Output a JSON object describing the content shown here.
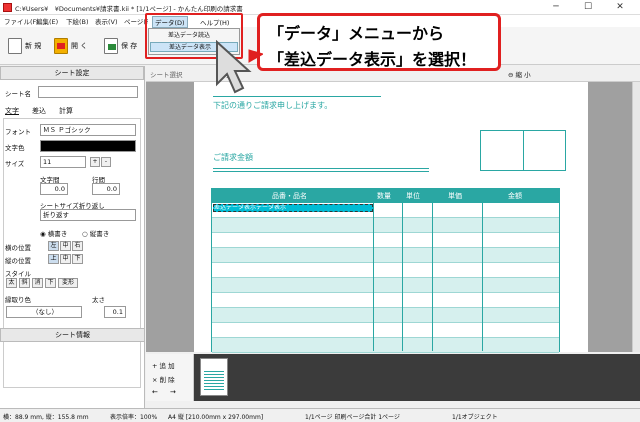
{
  "window": {
    "title": "C:¥Users¥　¥Documents¥請求書.kii * [1/1ページ] - かんたん印刷の請求書",
    "minimize": "─",
    "maximize": "☐",
    "close": "✕"
  },
  "menubar": [
    "ファイル(F)",
    "編集(E)",
    "下絵(B)",
    "表示(V)",
    "ページ(P)"
  ],
  "toolbar": {
    "new_label": "新 規",
    "open_label": "開 く",
    "save_label": "保 存"
  },
  "dropdown": {
    "menu_data": "データ(D)",
    "menu_help": "ヘルプ(H)",
    "items": [
      "差込データ読込",
      "差込データ表示"
    ]
  },
  "callout": {
    "line1": "「データ」メニューから",
    "line2": "「差込データ表示」を選択！"
  },
  "left_panel": {
    "header": "シート設定",
    "sheet_name_label": "シート名",
    "sheet_name_value": "",
    "tabs": [
      "文字",
      "差込",
      "計算"
    ],
    "font_label": "フォント",
    "font_value": "ＭＳ Ｐゴシック",
    "color_label": "文字色",
    "size_label": "サイズ",
    "size_value": "11",
    "char_spacing_label": "文字間",
    "char_spacing_value": "0.0",
    "line_spacing_label": "行間",
    "line_spacing_value": "0.0",
    "wrap_label": "シートサイズ折り返し",
    "wrap_value": "折り返す",
    "horizontal_label": "横書き",
    "vertical_label": "縦書き",
    "h_align_label": "横の位置",
    "h_align": [
      "左",
      "中",
      "右"
    ],
    "v_align_label": "縦の位置",
    "v_align": [
      "上",
      "中",
      "下"
    ],
    "style_label": "スタイル",
    "styles": [
      "太",
      "斜",
      "消",
      "下",
      "変形"
    ],
    "border_color_label": "縁取り色",
    "border_color_value": "（なし）",
    "thickness_label": "太さ",
    "thickness_value": "0.1",
    "footer": "シート情報"
  },
  "subtoolbar": {
    "select_label": "シート選択",
    "text_label": "文 字",
    "zoom_out_label": "縮 小"
  },
  "document": {
    "greeting": "下記の通りご請求申し上げます。",
    "amount_label": "ご請求金額",
    "table_headers": [
      "品番・品名",
      "数量",
      "単位",
      "単価",
      "金額"
    ],
    "selected_cell_text": "差込データ表示データ表示"
  },
  "thumb_panel": {
    "add_label": "追 加",
    "delete_label": "削 除"
  },
  "status": {
    "position": "横：88.9 mm, 縦：155.8 mm",
    "zoom": "表示倍率：100%",
    "paper": "A4 縦 [210.00mm x 297.00mm]",
    "page": "1/1ページ 印刷ページ合計 1ページ",
    "objects": "1/1オブジェクト"
  },
  "colors": {
    "accent": "#e02020",
    "teal": "#2aa7a3",
    "teal_light": "#d6f0ee"
  }
}
